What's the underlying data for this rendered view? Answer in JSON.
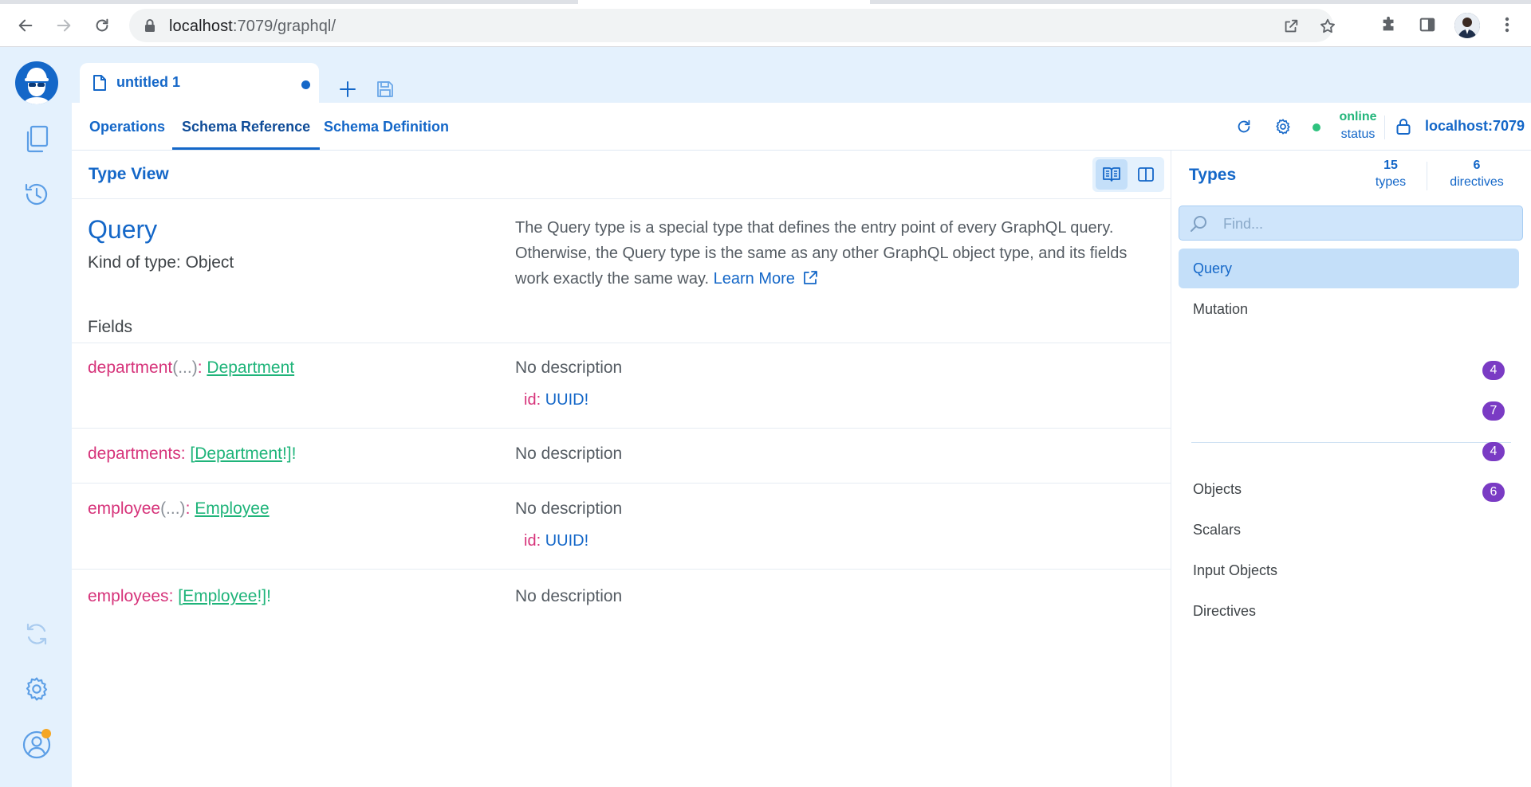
{
  "browser": {
    "url_host": "localhost",
    "url_path": ":7079/graphql/"
  },
  "tab": {
    "title": "untitled 1"
  },
  "subnav": {
    "tabs": [
      "Operations",
      "Schema Reference",
      "Schema Definition"
    ],
    "active_tab": "Schema Reference",
    "status_value": "online",
    "status_label": "status",
    "host": "localhost:7079"
  },
  "type_view": {
    "title": "Type View",
    "type_name": "Query",
    "kind": "Kind of type: Object",
    "description": "The Query type is a special type that defines the entry point of every GraphQL query. Otherwise, the Query type is the same as any other GraphQL object type, and its fields work exactly the same way.",
    "learn_more": "Learn More",
    "fields_label": "Fields",
    "fields": [
      {
        "name": "department",
        "args_hint": "(...)",
        "sep": ": ",
        "type": "Department",
        "prefix": "",
        "suffix": "",
        "description": "No description",
        "arg_name": "id",
        "arg_sep": ": ",
        "arg_type": "UUID!"
      },
      {
        "name": "departments",
        "args_hint": "",
        "sep": ": ",
        "type": "Department",
        "prefix": "[",
        "suffix": "!]!",
        "description": "No description"
      },
      {
        "name": "employee",
        "args_hint": "(...)",
        "sep": ": ",
        "type": "Employee",
        "prefix": "",
        "suffix": "",
        "description": "No description",
        "arg_name": "id",
        "arg_sep": ": ",
        "arg_type": "UUID!"
      },
      {
        "name": "employees",
        "args_hint": "",
        "sep": ": ",
        "type": "Employee",
        "prefix": "[",
        "suffix": "!]!",
        "description": "No description"
      }
    ]
  },
  "types_panel": {
    "title": "Types",
    "types_count": "15",
    "types_label": "types",
    "directives_count": "6",
    "directives_label": "directives",
    "search_placeholder": "Find...",
    "roots": [
      "Query",
      "Mutation"
    ],
    "selected": "Query",
    "categories": [
      {
        "label": "Objects",
        "count": "4"
      },
      {
        "label": "Scalars",
        "count": "7"
      },
      {
        "label": "Input Objects",
        "count": "4"
      },
      {
        "label": "Directives",
        "count": "6"
      }
    ]
  },
  "colors": {
    "accent": "#1467c8",
    "field_name": "#d6337a",
    "type_link": "#1fb47a",
    "online": "#22b57a",
    "badge": "#7a3bc4",
    "app_bg": "#e4f1fd"
  }
}
